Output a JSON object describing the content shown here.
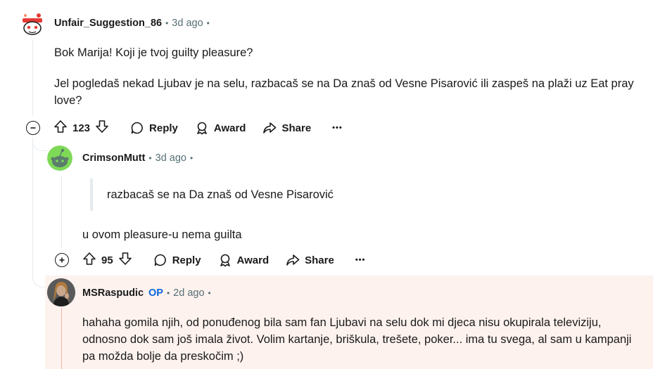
{
  "comment1": {
    "username": "Unfair_Suggestion_86",
    "time": "3d ago",
    "paragraphs": [
      "Bok Marija! Koji je tvoj guilty pleasure?",
      "Jel pogledaš nekad Ljubav je na selu, razbacaš se na Da znaš od Vesne Pisarović ili zaspeš na plaži uz Eat pray love?"
    ],
    "votes": "123",
    "reply": "Reply",
    "award": "Award",
    "share": "Share",
    "more": "•••"
  },
  "comment2": {
    "username": "CrimsonMutt",
    "time": "3d ago",
    "quote": "razbacaš se na Da znaš od Vesne Pisarović",
    "text": "u ovom pleasure-u nema guilta",
    "votes": "95",
    "reply": "Reply",
    "award": "Award",
    "share": "Share",
    "more": "•••"
  },
  "comment3": {
    "username": "MSRaspudic",
    "op_badge": "OP",
    "time": "2d ago",
    "text": "hahaha gomila njih, od ponuđenog bila sam fan Ljubavi na selu dok mi djeca nisu okupirala televiziju, odnosno dok sam još imala život. Volim kartanje, briškula, trešete, poker... ima tu svega, al sam u kampanji pa možda bolje da preskočim ;)"
  },
  "colors": {
    "op_highlight": "#fdf2ee",
    "op_badge": "#0a66d9",
    "thread_line": "#e5ebee"
  }
}
